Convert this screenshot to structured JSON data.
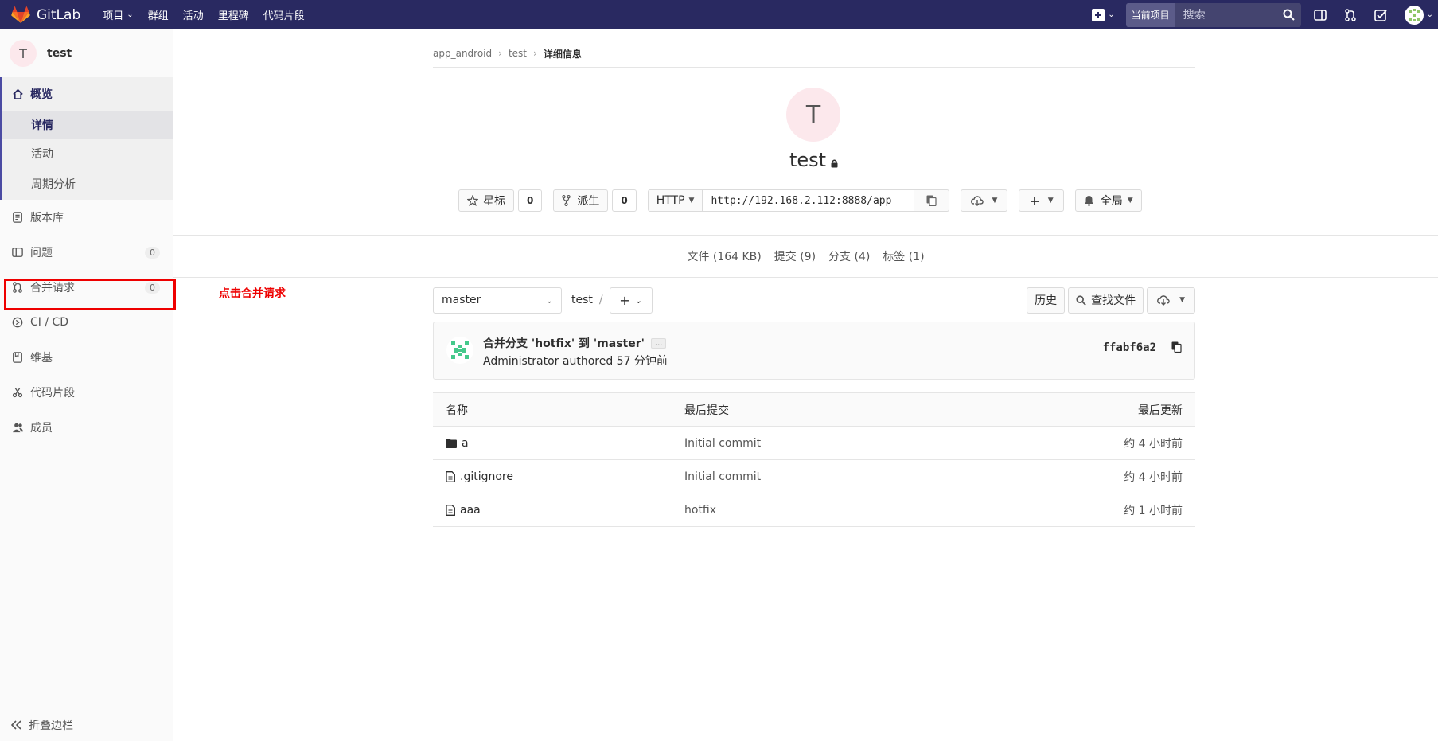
{
  "app": {
    "name": "GitLab"
  },
  "topnav": {
    "items": [
      {
        "label": "项目",
        "dropdown": true
      },
      {
        "label": "群组"
      },
      {
        "label": "活动"
      },
      {
        "label": "里程碑"
      },
      {
        "label": "代码片段"
      }
    ],
    "search_scope": "当前项目",
    "search_placeholder": "搜索"
  },
  "sidebar": {
    "project_initial": "T",
    "project_name": "test",
    "overview": {
      "label": "概览",
      "sub": [
        "详情",
        "活动",
        "周期分析"
      ]
    },
    "items": [
      {
        "label": "版本库",
        "icon": "repository-icon"
      },
      {
        "label": "问题",
        "icon": "issues-icon",
        "badge": "0"
      },
      {
        "label": "合并请求",
        "icon": "merge-request-icon",
        "badge": "0"
      },
      {
        "label": "CI / CD",
        "icon": "ci-cd-icon"
      },
      {
        "label": "维基",
        "icon": "wiki-icon"
      },
      {
        "label": "代码片段",
        "icon": "snippets-icon"
      },
      {
        "label": "成员",
        "icon": "members-icon"
      }
    ],
    "collapse_label": "折叠边栏"
  },
  "annotation": {
    "text": "点击合并请求",
    "color": "#e00000"
  },
  "breadcrumb": {
    "group": "app_android",
    "project": "test",
    "current": "详细信息"
  },
  "project": {
    "initial": "T",
    "name": "test",
    "star_label": "星标",
    "star_count": "0",
    "fork_label": "派生",
    "fork_count": "0",
    "protocol": "HTTP",
    "clone_url": "http://192.168.2.112:8888/app",
    "notification": "全局"
  },
  "stats": {
    "files": "文件 (164 KB)",
    "commits": "提交 (9)",
    "branches": "分支 (4)",
    "tags": "标签 (1)"
  },
  "tree": {
    "branch": "master",
    "path": "test",
    "path_sep": "/",
    "history": "历史",
    "find_file": "查找文件"
  },
  "commit": {
    "title": "合并分支 'hotfix' 到 'master'",
    "ellipsis": "...",
    "meta": "Administrator authored 57 分钟前",
    "sha": "ffabf6a2"
  },
  "files": {
    "headers": [
      "名称",
      "最后提交",
      "最后更新"
    ],
    "rows": [
      {
        "name": "a",
        "type": "folder",
        "commit": "Initial commit",
        "updated": "约 4 小时前"
      },
      {
        "name": ".gitignore",
        "type": "file",
        "commit": "Initial commit",
        "updated": "约 4 小时前"
      },
      {
        "name": "aaa",
        "type": "file",
        "commit": "hotfix",
        "updated": "约 1 小时前"
      }
    ]
  },
  "colors": {
    "topbar": "#292961",
    "accent": "#4b4ba3",
    "highlight": "#e00000"
  }
}
